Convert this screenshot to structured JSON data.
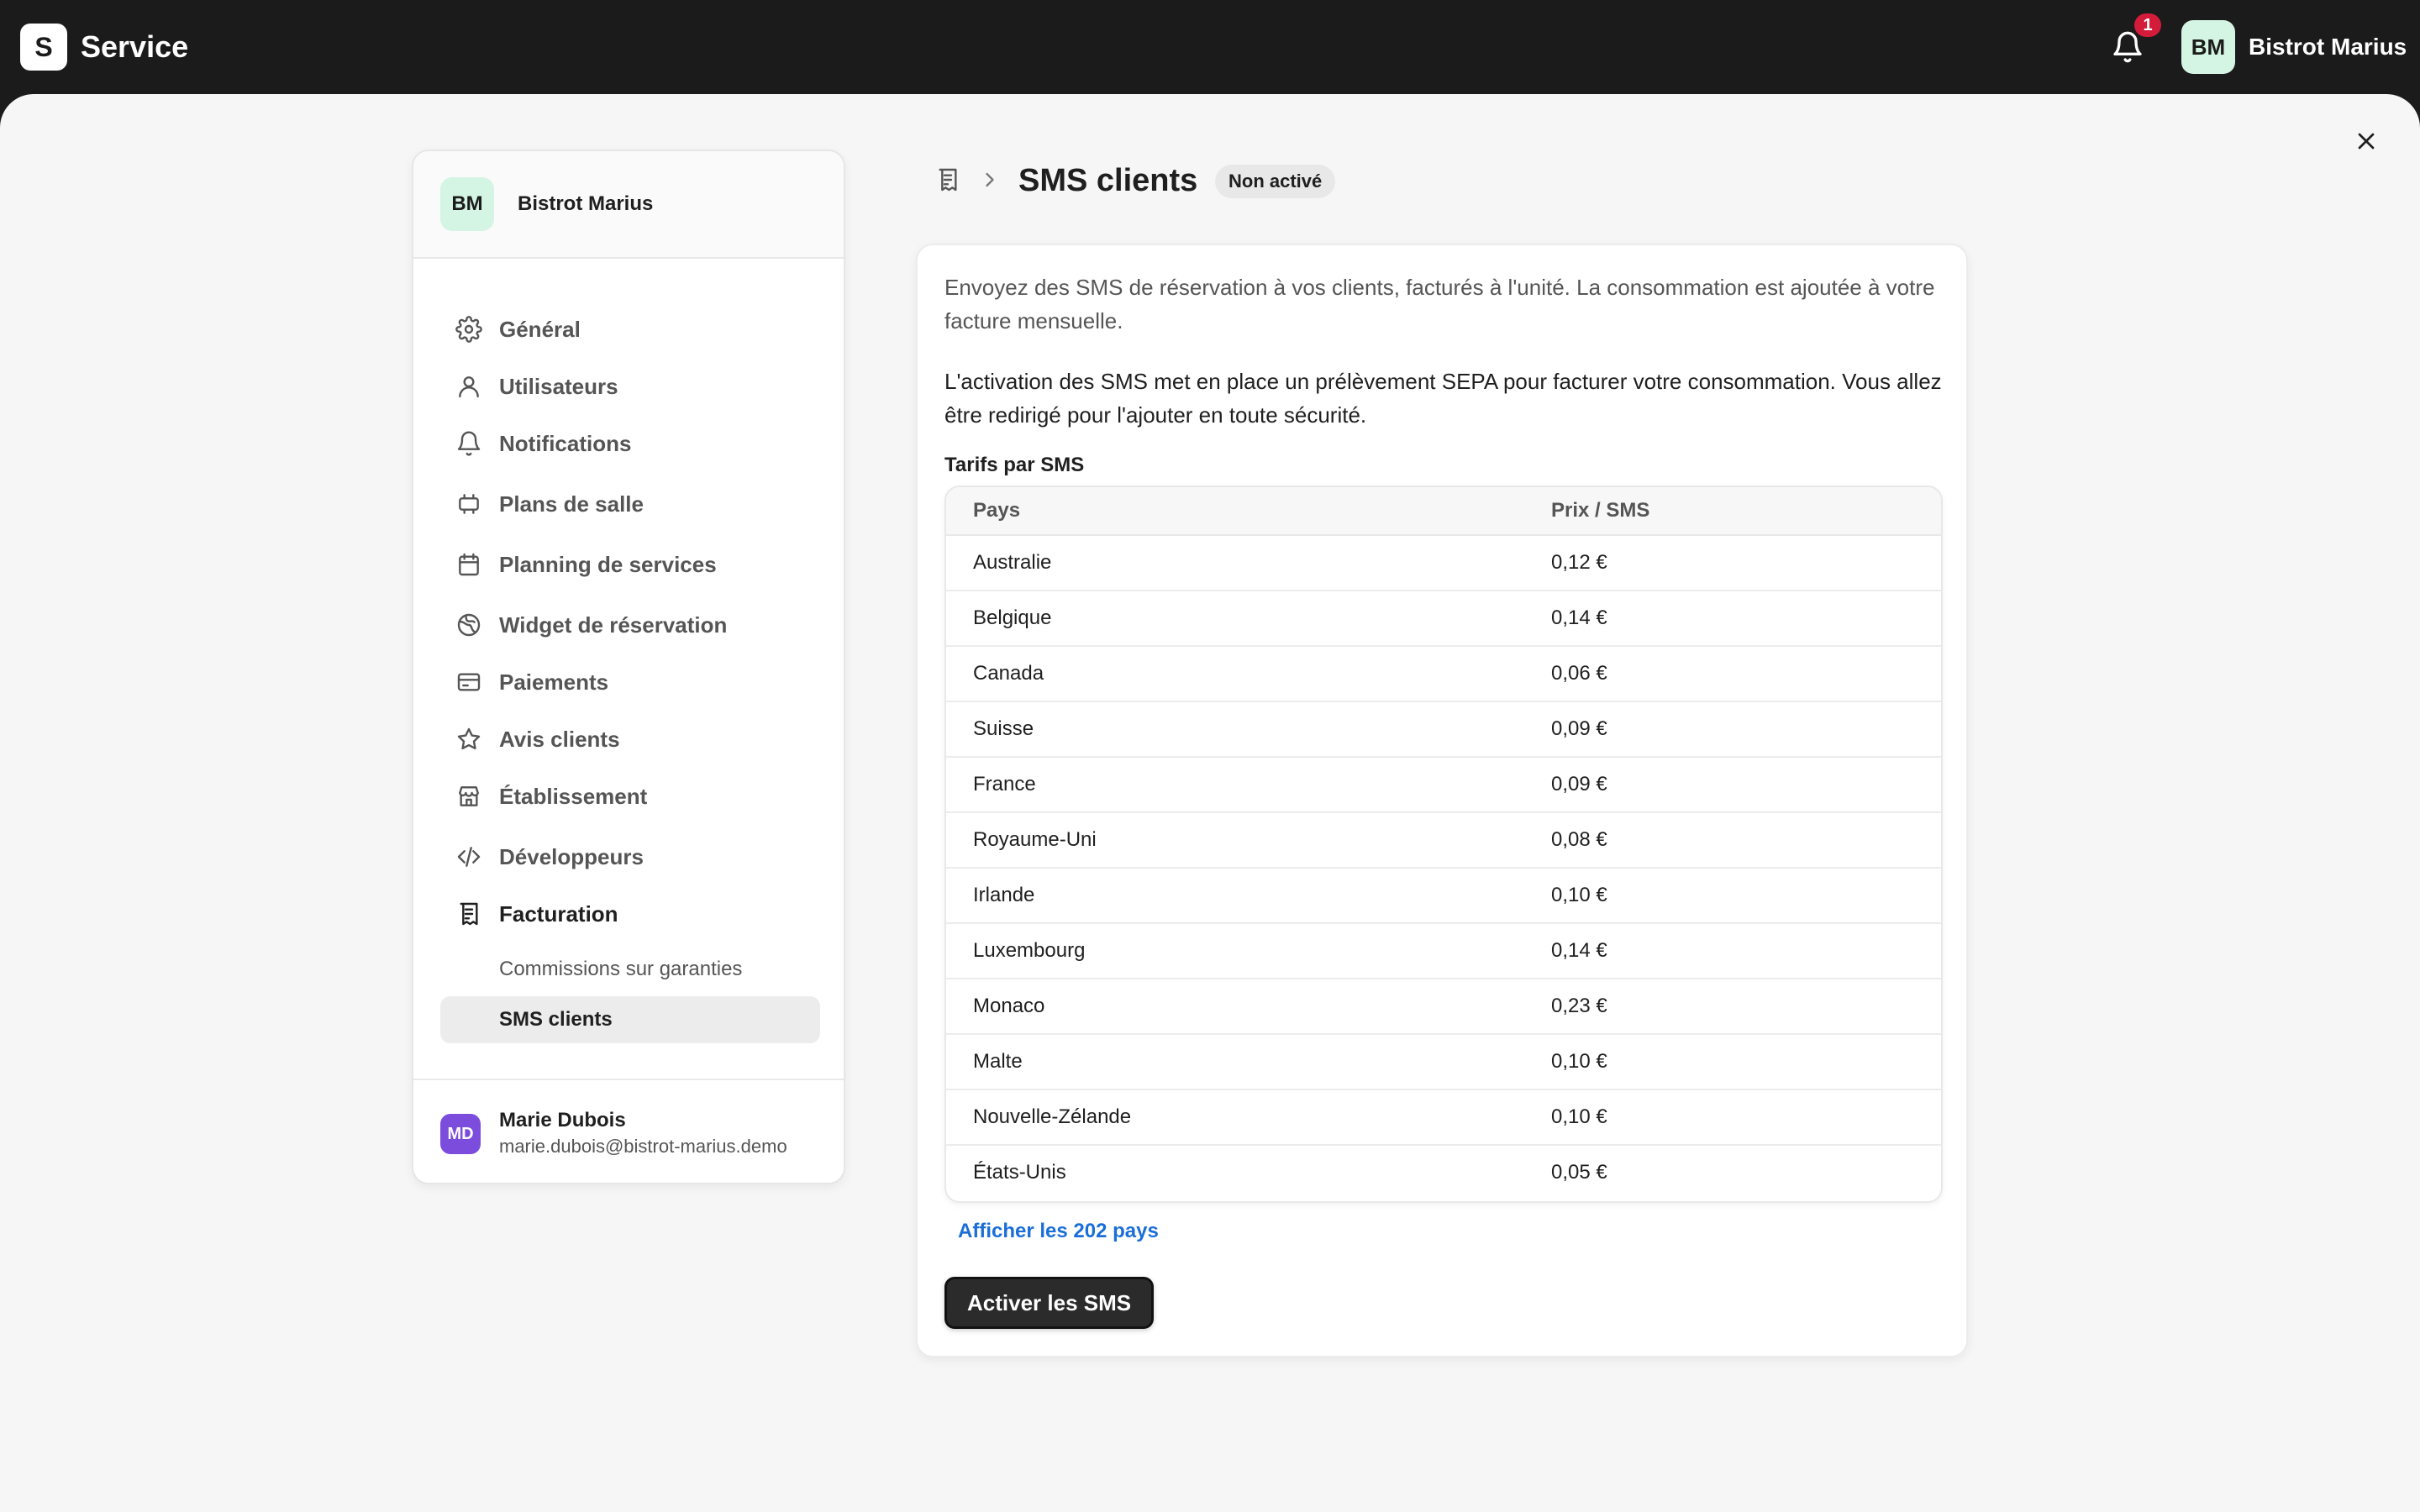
{
  "header": {
    "logo_letter": "S",
    "app_name": "Service",
    "notification_count": "1",
    "account_initials": "BM",
    "account_name": "Bistrot Marius"
  },
  "sidebar": {
    "venue_initials": "BM",
    "venue_name": "Bistrot Marius",
    "items": [
      {
        "label": "Général",
        "icon": "gear-icon"
      },
      {
        "label": "Utilisateurs",
        "icon": "user-icon"
      },
      {
        "label": "Notifications",
        "icon": "bell-icon"
      },
      {
        "label": "Plans de salle",
        "icon": "table-icon"
      },
      {
        "label": "Planning de services",
        "icon": "calendar-icon"
      },
      {
        "label": "Widget de réservation",
        "icon": "globe-icon"
      },
      {
        "label": "Paiements",
        "icon": "credit-card-icon"
      },
      {
        "label": "Avis clients",
        "icon": "star-icon"
      },
      {
        "label": "Établissement",
        "icon": "store-icon"
      },
      {
        "label": "Développeurs",
        "icon": "code-icon"
      },
      {
        "label": "Facturation",
        "icon": "receipt-icon"
      }
    ],
    "subitems": [
      {
        "label": "Commissions sur garanties"
      },
      {
        "label": "SMS clients"
      }
    ],
    "user": {
      "initials": "MD",
      "name": "Marie Dubois",
      "email": "marie.dubois@bistrot-marius.demo"
    }
  },
  "main": {
    "title": "SMS clients",
    "status": "Non activé",
    "intro": "Envoyez des SMS de réservation à vos clients, facturés à l'unité. La consommation est ajoutée à votre facture mensuelle.",
    "notice": "L'activation des SMS met en place un prélèvement SEPA pour facturer votre consommation. Vous allez être redirigé pour l'ajouter en toute sécurité.",
    "table_title": "Tarifs par SMS",
    "columns": [
      "Pays",
      "Prix / SMS"
    ],
    "rows": [
      [
        "Australie",
        "0,12 €"
      ],
      [
        "Belgique",
        "0,14 €"
      ],
      [
        "Canada",
        "0,06 €"
      ],
      [
        "Suisse",
        "0,09 €"
      ],
      [
        "France",
        "0,09 €"
      ],
      [
        "Royaume-Uni",
        "0,08 €"
      ],
      [
        "Irlande",
        "0,10 €"
      ],
      [
        "Luxembourg",
        "0,14 €"
      ],
      [
        "Monaco",
        "0,23 €"
      ],
      [
        "Malte",
        "0,10 €"
      ],
      [
        "Nouvelle-Zélande",
        "0,10 €"
      ],
      [
        "États-Unis",
        "0,05 €"
      ]
    ],
    "show_all_link": "Afficher les 202 pays",
    "activate_button": "Activer les SMS"
  },
  "colors": {
    "topbar": "#1b1b1b",
    "badge": "#d21c3a",
    "link": "#1a6ed8",
    "venue_avatar": "#d4f5e3",
    "user_avatar": "#7c4ddc"
  }
}
